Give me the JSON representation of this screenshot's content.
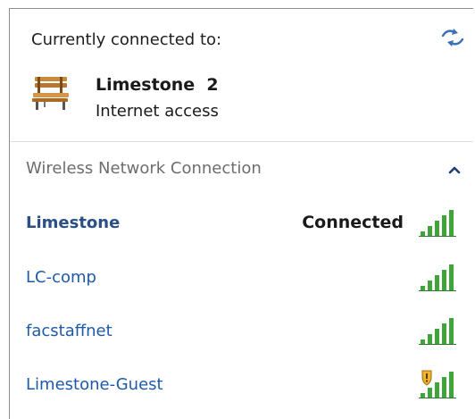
{
  "header": {
    "connected_label": "Currently connected to:",
    "refresh_icon": "network-refresh-icon"
  },
  "current_network": {
    "name": "Limestone  2",
    "status": "Internet access",
    "icon": "public-network-bench-icon"
  },
  "section": {
    "title": "Wireless Network Connection",
    "collapse_icon": "chevron-up-icon"
  },
  "networks": [
    {
      "name": "Limestone",
      "status": "Connected",
      "signal_bars": 5,
      "secured": true,
      "shield": false
    },
    {
      "name": "LC-comp",
      "status": "",
      "signal_bars": 5,
      "secured": true,
      "shield": false
    },
    {
      "name": "facstaffnet",
      "status": "",
      "signal_bars": 5,
      "secured": true,
      "shield": false
    },
    {
      "name": "Limestone-Guest",
      "status": "",
      "signal_bars": 5,
      "secured": false,
      "shield": true
    }
  ],
  "colors": {
    "link": "#1e5aa8",
    "signal_green": "#3fa43a",
    "header_text": "#6d6d6d"
  }
}
